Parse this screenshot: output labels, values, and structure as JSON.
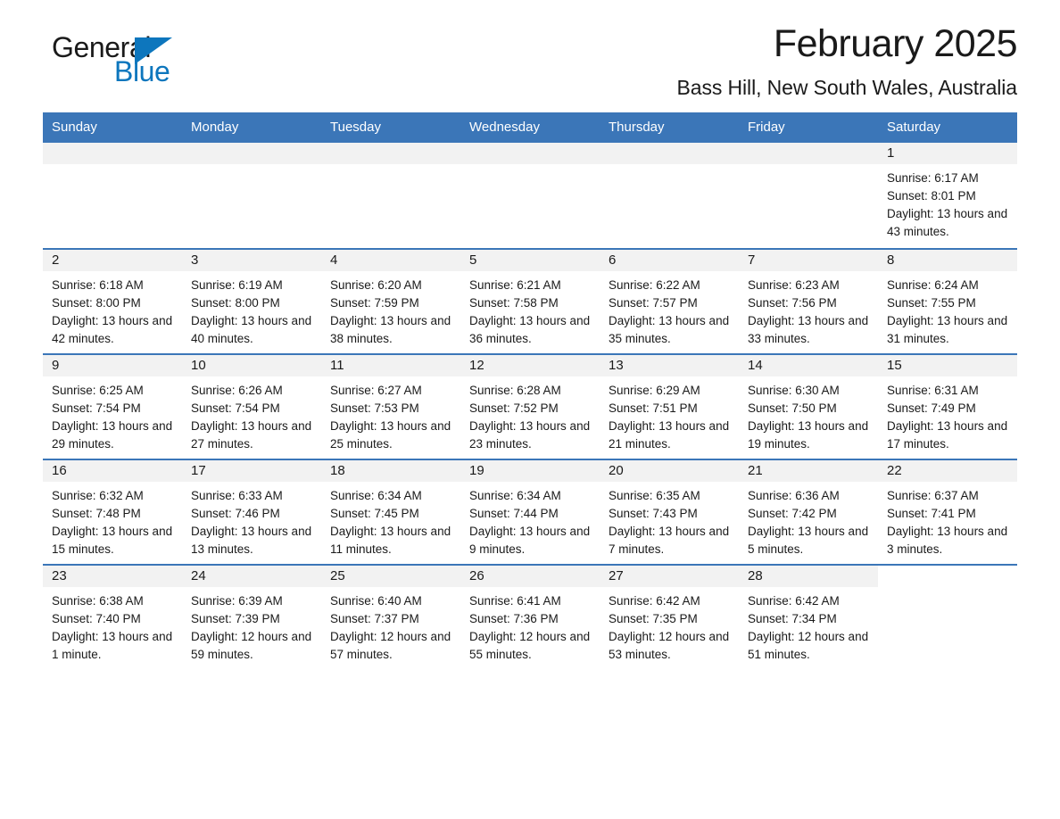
{
  "brand": {
    "name_part1": "General",
    "name_part2": "Blue",
    "logo_icon": "triangle-icon"
  },
  "header": {
    "month_title": "February 2025",
    "location": "Bass Hill, New South Wales, Australia"
  },
  "colors": {
    "header_blue": "#3b76b8",
    "brand_blue": "#0d76bd",
    "daynum_bg": "#f2f2f2",
    "text": "#1a1a1a"
  },
  "calendar": {
    "weekday_headers": [
      "Sunday",
      "Monday",
      "Tuesday",
      "Wednesday",
      "Thursday",
      "Friday",
      "Saturday"
    ],
    "weeks": [
      [
        {
          "blank": true
        },
        {
          "blank": true
        },
        {
          "blank": true
        },
        {
          "blank": true
        },
        {
          "blank": true
        },
        {
          "blank": true
        },
        {
          "day": "1",
          "sunrise": "Sunrise: 6:17 AM",
          "sunset": "Sunset: 8:01 PM",
          "daylight": "Daylight: 13 hours and 43 minutes."
        }
      ],
      [
        {
          "day": "2",
          "sunrise": "Sunrise: 6:18 AM",
          "sunset": "Sunset: 8:00 PM",
          "daylight": "Daylight: 13 hours and 42 minutes."
        },
        {
          "day": "3",
          "sunrise": "Sunrise: 6:19 AM",
          "sunset": "Sunset: 8:00 PM",
          "daylight": "Daylight: 13 hours and 40 minutes."
        },
        {
          "day": "4",
          "sunrise": "Sunrise: 6:20 AM",
          "sunset": "Sunset: 7:59 PM",
          "daylight": "Daylight: 13 hours and 38 minutes."
        },
        {
          "day": "5",
          "sunrise": "Sunrise: 6:21 AM",
          "sunset": "Sunset: 7:58 PM",
          "daylight": "Daylight: 13 hours and 36 minutes."
        },
        {
          "day": "6",
          "sunrise": "Sunrise: 6:22 AM",
          "sunset": "Sunset: 7:57 PM",
          "daylight": "Daylight: 13 hours and 35 minutes."
        },
        {
          "day": "7",
          "sunrise": "Sunrise: 6:23 AM",
          "sunset": "Sunset: 7:56 PM",
          "daylight": "Daylight: 13 hours and 33 minutes."
        },
        {
          "day": "8",
          "sunrise": "Sunrise: 6:24 AM",
          "sunset": "Sunset: 7:55 PM",
          "daylight": "Daylight: 13 hours and 31 minutes."
        }
      ],
      [
        {
          "day": "9",
          "sunrise": "Sunrise: 6:25 AM",
          "sunset": "Sunset: 7:54 PM",
          "daylight": "Daylight: 13 hours and 29 minutes."
        },
        {
          "day": "10",
          "sunrise": "Sunrise: 6:26 AM",
          "sunset": "Sunset: 7:54 PM",
          "daylight": "Daylight: 13 hours and 27 minutes."
        },
        {
          "day": "11",
          "sunrise": "Sunrise: 6:27 AM",
          "sunset": "Sunset: 7:53 PM",
          "daylight": "Daylight: 13 hours and 25 minutes."
        },
        {
          "day": "12",
          "sunrise": "Sunrise: 6:28 AM",
          "sunset": "Sunset: 7:52 PM",
          "daylight": "Daylight: 13 hours and 23 minutes."
        },
        {
          "day": "13",
          "sunrise": "Sunrise: 6:29 AM",
          "sunset": "Sunset: 7:51 PM",
          "daylight": "Daylight: 13 hours and 21 minutes."
        },
        {
          "day": "14",
          "sunrise": "Sunrise: 6:30 AM",
          "sunset": "Sunset: 7:50 PM",
          "daylight": "Daylight: 13 hours and 19 minutes."
        },
        {
          "day": "15",
          "sunrise": "Sunrise: 6:31 AM",
          "sunset": "Sunset: 7:49 PM",
          "daylight": "Daylight: 13 hours and 17 minutes."
        }
      ],
      [
        {
          "day": "16",
          "sunrise": "Sunrise: 6:32 AM",
          "sunset": "Sunset: 7:48 PM",
          "daylight": "Daylight: 13 hours and 15 minutes."
        },
        {
          "day": "17",
          "sunrise": "Sunrise: 6:33 AM",
          "sunset": "Sunset: 7:46 PM",
          "daylight": "Daylight: 13 hours and 13 minutes."
        },
        {
          "day": "18",
          "sunrise": "Sunrise: 6:34 AM",
          "sunset": "Sunset: 7:45 PM",
          "daylight": "Daylight: 13 hours and 11 minutes."
        },
        {
          "day": "19",
          "sunrise": "Sunrise: 6:34 AM",
          "sunset": "Sunset: 7:44 PM",
          "daylight": "Daylight: 13 hours and 9 minutes."
        },
        {
          "day": "20",
          "sunrise": "Sunrise: 6:35 AM",
          "sunset": "Sunset: 7:43 PM",
          "daylight": "Daylight: 13 hours and 7 minutes."
        },
        {
          "day": "21",
          "sunrise": "Sunrise: 6:36 AM",
          "sunset": "Sunset: 7:42 PM",
          "daylight": "Daylight: 13 hours and 5 minutes."
        },
        {
          "day": "22",
          "sunrise": "Sunrise: 6:37 AM",
          "sunset": "Sunset: 7:41 PM",
          "daylight": "Daylight: 13 hours and 3 minutes."
        }
      ],
      [
        {
          "day": "23",
          "sunrise": "Sunrise: 6:38 AM",
          "sunset": "Sunset: 7:40 PM",
          "daylight": "Daylight: 13 hours and 1 minute."
        },
        {
          "day": "24",
          "sunrise": "Sunrise: 6:39 AM",
          "sunset": "Sunset: 7:39 PM",
          "daylight": "Daylight: 12 hours and 59 minutes."
        },
        {
          "day": "25",
          "sunrise": "Sunrise: 6:40 AM",
          "sunset": "Sunset: 7:37 PM",
          "daylight": "Daylight: 12 hours and 57 minutes."
        },
        {
          "day": "26",
          "sunrise": "Sunrise: 6:41 AM",
          "sunset": "Sunset: 7:36 PM",
          "daylight": "Daylight: 12 hours and 55 minutes."
        },
        {
          "day": "27",
          "sunrise": "Sunrise: 6:42 AM",
          "sunset": "Sunset: 7:35 PM",
          "daylight": "Daylight: 12 hours and 53 minutes."
        },
        {
          "day": "28",
          "sunrise": "Sunrise: 6:42 AM",
          "sunset": "Sunset: 7:34 PM",
          "daylight": "Daylight: 12 hours and 51 minutes."
        },
        {
          "blank": true
        }
      ]
    ]
  }
}
